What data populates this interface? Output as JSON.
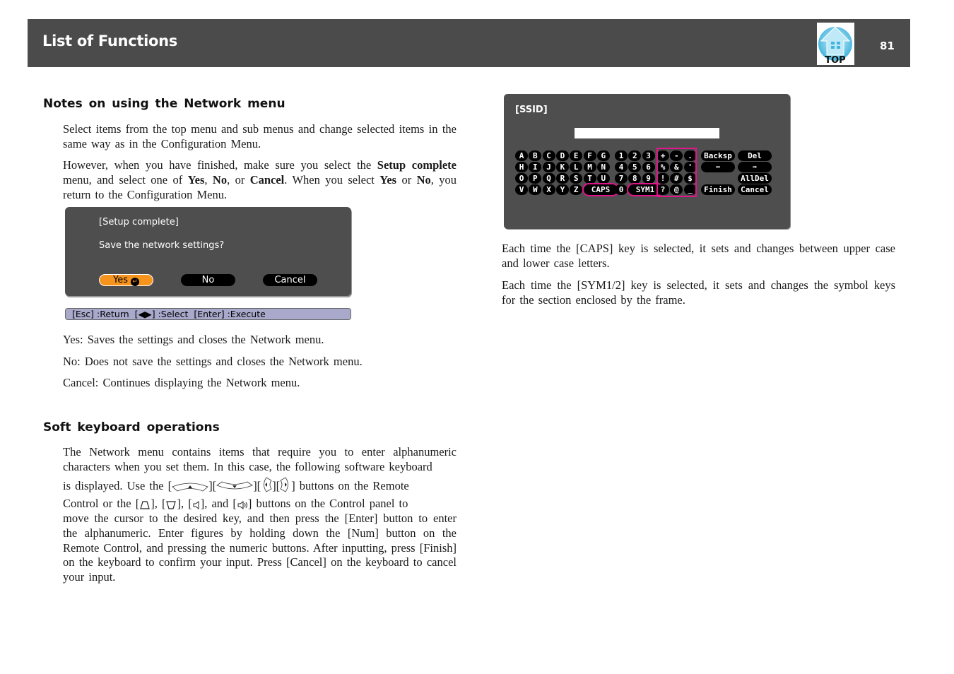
{
  "header": {
    "title": "List of Functions",
    "top_label": "TOP",
    "page_number": "81"
  },
  "section1": {
    "heading": "Notes on using the Network menu",
    "p1": "Select items from the top menu and sub menus and change selected items in the same way as in the Configuration Menu.",
    "p2_parts": {
      "a": "However, when you have finished, make sure you select the ",
      "b": "Setup complete",
      "c": " menu, and select one of ",
      "d": "Yes",
      "e": ", ",
      "f": "No",
      "g": ", or ",
      "h": "Cancel",
      "i": ". When you select ",
      "j": "Yes",
      "k": " or ",
      "l": "No",
      "m": ", you return to the Configuration Menu."
    },
    "dialog": {
      "title": "[Setup complete]",
      "question": "Save the network settings?",
      "buttons": [
        "Yes",
        "No",
        "Cancel"
      ],
      "selected": "Yes",
      "help_bar": "[Esc] :Return  [◀▶] :Select  [Enter] :Execute"
    },
    "yes_desc": "Yes: Saves the settings and closes the Network menu.",
    "no_desc": "No: Does not save the settings and closes the Network menu.",
    "cancel_desc": "Cancel: Continues displaying the Network menu."
  },
  "section2": {
    "heading": "Soft keyboard operations",
    "p1_line1": "The Network menu contains items that require you to enter alphanumeric characters when you set them. In this case, the following software keyboard",
    "p1_line2a": "is displayed. Use the [",
    "p1_line2b": "][",
    "p1_line2c": "][",
    "p1_line2d": "][",
    "p1_line2e": "] buttons on the Remote",
    "p1_line3a": "Control or the [",
    "p1_line3b": "], [",
    "p1_line3c": "], [",
    "p1_line3d": "], and [",
    "p1_line3e": "] buttons on the Control panel to",
    "p1_rest": "move the cursor to the desired key, and then press the [Enter] button to enter the alphanumeric. Enter figures by holding down the [Num] button on the Remote Control, and pressing the numeric buttons. After inputting, press [Finish] on the keyboard to confirm your input. Press [Cancel] on the keyboard to cancel your input."
  },
  "keyboard": {
    "title": "[SSID]",
    "input_value": "",
    "letter_rows": [
      [
        "A",
        "B",
        "C",
        "D",
        "E",
        "F",
        "G"
      ],
      [
        "H",
        "I",
        "J",
        "K",
        "L",
        "M",
        "N"
      ],
      [
        "O",
        "P",
        "Q",
        "R",
        "S",
        "T",
        "U"
      ],
      [
        "V",
        "W",
        "X",
        "Y",
        "Z"
      ]
    ],
    "caps_key": "CAPS",
    "number_rows": [
      [
        "1",
        "2",
        "3"
      ],
      [
        "4",
        "5",
        "6"
      ],
      [
        "7",
        "8",
        "9"
      ],
      [
        "0"
      ]
    ],
    "sym_key": "SYM1",
    "symbol_rows": [
      [
        "+",
        "-",
        "."
      ],
      [
        "%",
        "&",
        "'"
      ],
      [
        "!",
        "#",
        "$"
      ],
      [
        "?",
        "@",
        "_"
      ]
    ],
    "function_keys": {
      "backspace": "Backsp",
      "delete": "Del",
      "left": "⬅",
      "right": "➡",
      "all_delete": "AllDel",
      "finish": "Finish",
      "cancel": "Cancel"
    },
    "highlight_color": "#e0158a"
  },
  "right_text": {
    "p1": "Each time the [CAPS] key is selected, it sets and changes between upper case and lower case letters.",
    "p2": "Each time the [SYM1/2] key is selected, it sets and changes the symbol keys for the section enclosed by the frame."
  },
  "colors": {
    "header_bg": "#4b4b4b",
    "dialog_bg": "#4e4e4e",
    "selected_button": "#f7941d",
    "help_bar_bg": "#a9a9cc",
    "top_icon": "#3fb4dc"
  }
}
